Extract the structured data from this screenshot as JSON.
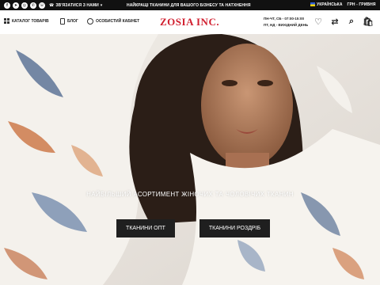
{
  "topbar": {
    "socials": [
      "facebook-icon",
      "telegram-icon",
      "instagram-icon",
      "whatsapp-icon",
      "viber-icon"
    ],
    "contact_label": "ЗВ'ЯЗАТИСЯ З НАМИ",
    "promo": "НАЙКРАЩІ ТКАНИНИ ДЛЯ ВАШОГО БІЗНЕСУ ТА НАТХНЕННЯ",
    "language": "УКРАЇНСЬКА",
    "currency": "ГРН - ГРИВНЯ"
  },
  "header": {
    "catalog": "КАТАЛОГ ТОВАРІВ",
    "blog": "БЛОГ",
    "account": "ОСОБИСТИЙ КАБІНЕТ",
    "logo": "ZOSIA INC.",
    "hours_line1": "ПН-ЧТ, СБ - 07:00-15:00",
    "hours_line2": "ПТ, НД - ВИХІДНИЙ ДЕНЬ",
    "icons": [
      "heart-icon",
      "compare-icon",
      "search-icon",
      "cart-icon"
    ]
  },
  "hero": {
    "tagline": "НАЙБІЛЬШИЙ АСОРТИМЕНТ ЖІНОЧИХ ТА ЧОЛОВІЧИХ ТКАНИН",
    "btn_wholesale": "ТКАНИНИ ОПТ",
    "btn_retail": "ТКАНИНИ РОЗДРІБ"
  },
  "colors": {
    "topbar_bg": "#111111",
    "brand_red": "#d11f2f",
    "button_bg": "#1f1f1f"
  }
}
